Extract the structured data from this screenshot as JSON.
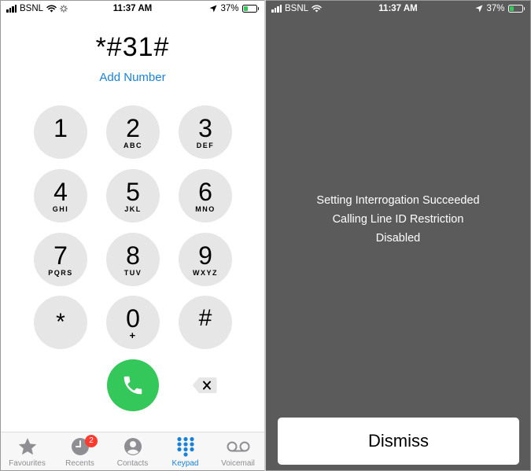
{
  "left_phone": {
    "status": {
      "carrier": "BSNL",
      "time": "11:37 AM",
      "battery_percent": "37%",
      "battery_level": 0.37,
      "battery_color": "#34c759",
      "icons": [
        "signal-icon",
        "wifi-icon",
        "activity-spinner-icon",
        "location-arrow-icon",
        "battery-charging-icon"
      ]
    },
    "dialed_number": "*#31#",
    "add_number_label": "Add Number",
    "keypad": [
      {
        "digit": "1",
        "letters": ""
      },
      {
        "digit": "2",
        "letters": "ABC"
      },
      {
        "digit": "3",
        "letters": "DEF"
      },
      {
        "digit": "4",
        "letters": "GHI"
      },
      {
        "digit": "5",
        "letters": "JKL"
      },
      {
        "digit": "6",
        "letters": "MNO"
      },
      {
        "digit": "7",
        "letters": "PQRS"
      },
      {
        "digit": "8",
        "letters": "TUV"
      },
      {
        "digit": "9",
        "letters": "WXYZ"
      },
      {
        "digit": "*",
        "letters": ""
      },
      {
        "digit": "0",
        "letters": "+"
      },
      {
        "digit": "#",
        "letters": ""
      }
    ],
    "call_button_color": "#34c759",
    "tabs": [
      {
        "label": "Favourites",
        "icon": "star-icon",
        "active": false
      },
      {
        "label": "Recents",
        "icon": "clock-icon",
        "active": false,
        "badge": "2"
      },
      {
        "label": "Contacts",
        "icon": "contact-icon",
        "active": false
      },
      {
        "label": "Keypad",
        "icon": "keypad-icon",
        "active": true
      },
      {
        "label": "Voicemail",
        "icon": "voicemail-icon",
        "active": false
      }
    ],
    "accent_color": "#1a82d6"
  },
  "right_phone": {
    "status": {
      "carrier": "BSNL",
      "time": "11:37 AM",
      "battery_percent": "37%",
      "battery_level": 0.37,
      "battery_color": "#34c759"
    },
    "message_lines": [
      "Setting Interrogation Succeeded",
      "Calling Line ID Restriction",
      "Disabled"
    ],
    "dismiss_label": "Dismiss",
    "background_color": "#5b5b5b"
  }
}
